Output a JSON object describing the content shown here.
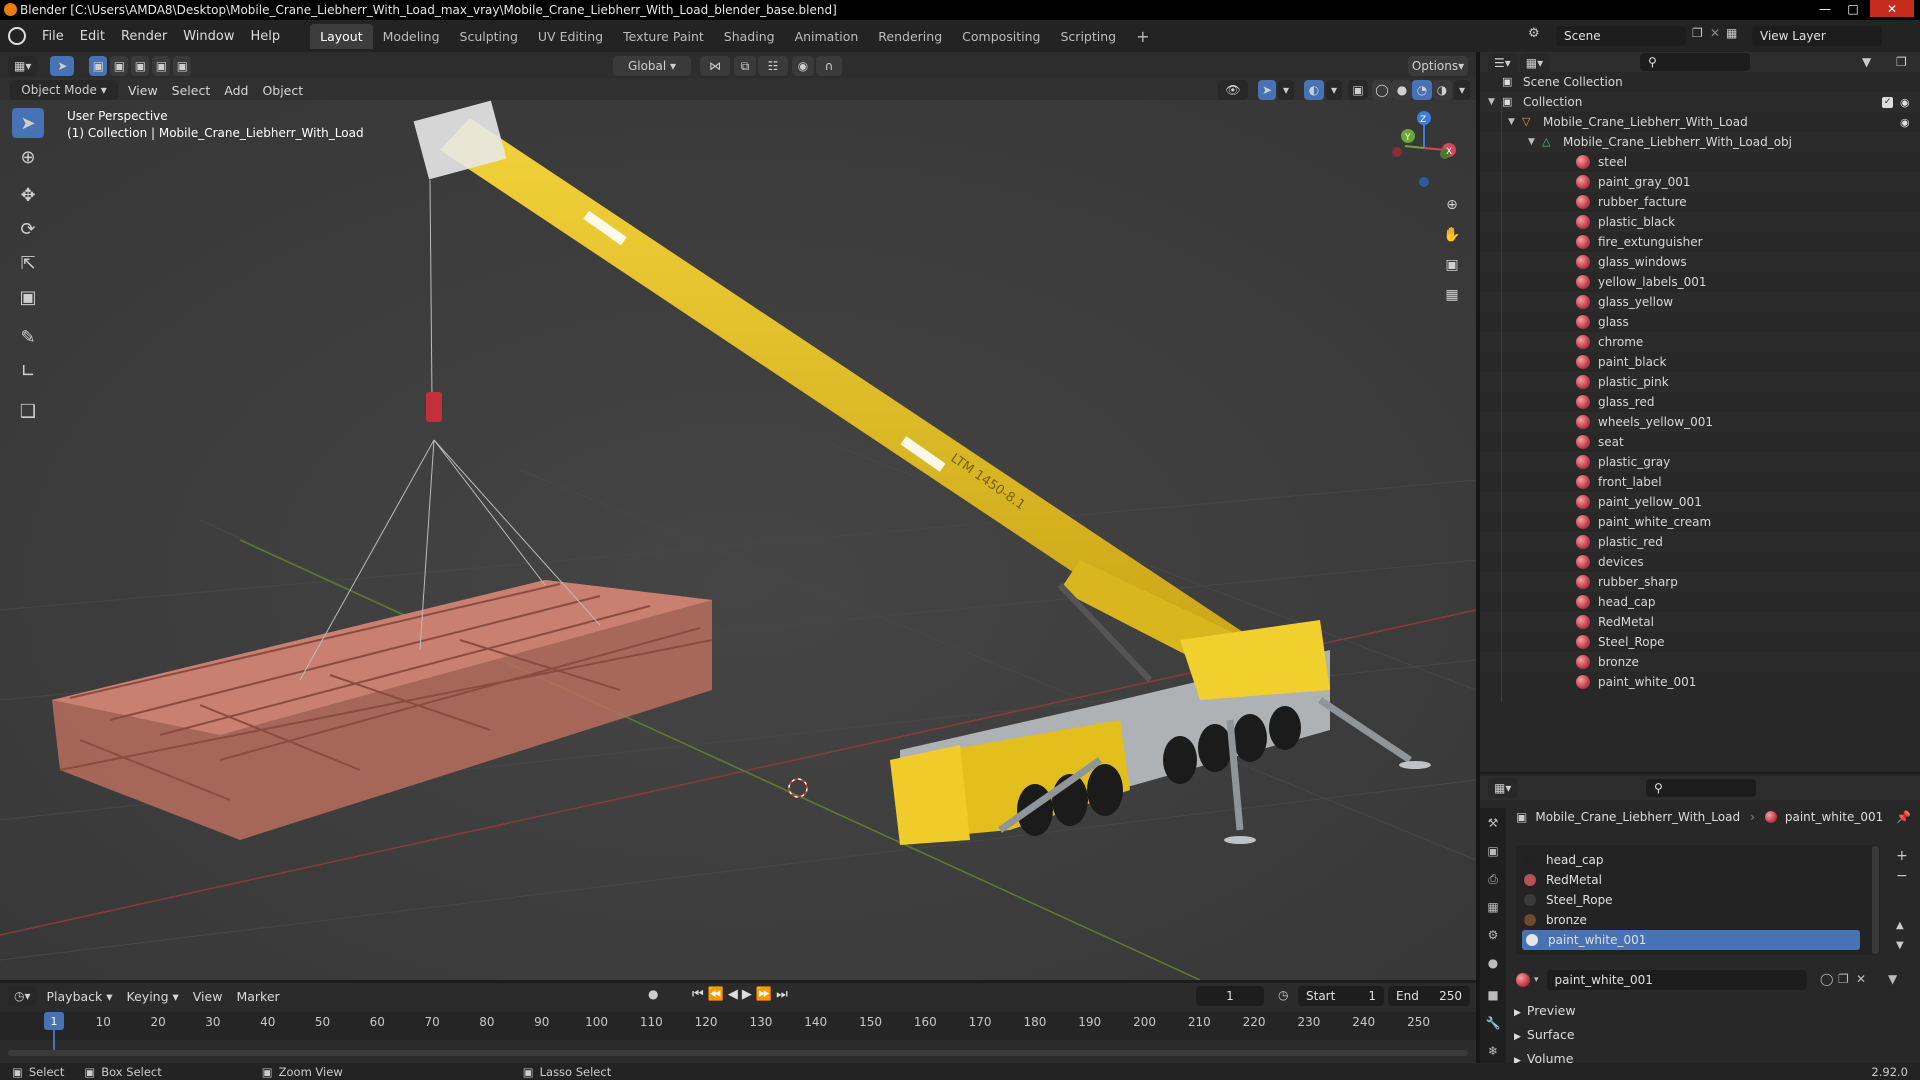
{
  "title": "Blender [C:\\Users\\AMDA8\\Desktop\\Mobile_Crane_Liebherr_With_Load_max_vray\\Mobile_Crane_Liebherr_With_Load_blender_base.blend]",
  "menu": [
    "File",
    "Edit",
    "Render",
    "Window",
    "Help"
  ],
  "workspaces": [
    "Layout",
    "Modeling",
    "Sculpting",
    "UV Editing",
    "Texture Paint",
    "Shading",
    "Animation",
    "Rendering",
    "Compositing",
    "Scripting"
  ],
  "scene_name": "Scene",
  "view_layer": "View Layer",
  "viewport_header": {
    "transform": "Global",
    "options": "Options",
    "mode": "Object Mode",
    "menus": [
      "View",
      "Select",
      "Add",
      "Object"
    ]
  },
  "overlay": {
    "perspective": "User Perspective",
    "collection": "(1) Collection | Mobile_Crane_Liebherr_With_Load"
  },
  "crane_label": "LTM 1450-8.1",
  "axes": {
    "x": "X",
    "y": "Y",
    "z": "Z"
  },
  "outliner": {
    "scene_collection": "Scene Collection",
    "collection": "Collection",
    "object": "Mobile_Crane_Liebherr_With_Load",
    "mesh": "Mobile_Crane_Liebherr_With_Load_obj",
    "materials": [
      "steel",
      "paint_gray_001",
      "rubber_facture",
      "plastic_black",
      "fire_extunguisher",
      "glass_windows",
      "yellow_labels_001",
      "glass_yellow",
      "glass",
      "chrome",
      "paint_black",
      "plastic_pink",
      "glass_red",
      "wheels_yellow_001",
      "seat",
      "plastic_gray",
      "front_label",
      "paint_yellow_001",
      "paint_white_cream",
      "plastic_red",
      "devices",
      "rubber_sharp",
      "head_cap",
      "RedMetal",
      "Steel_Rope",
      "bronze",
      "paint_white_001"
    ]
  },
  "properties": {
    "breadcrumb_object": "Mobile_Crane_Liebherr_With_Load",
    "breadcrumb_material": "paint_white_001",
    "slots": [
      {
        "name": "head_cap",
        "color": "#222222"
      },
      {
        "name": "RedMetal",
        "color": "#b5525a"
      },
      {
        "name": "Steel_Rope",
        "color": "#3a3a3a"
      },
      {
        "name": "bronze",
        "color": "#6b4a2f"
      },
      {
        "name": "paint_white_001",
        "color": "#e6e6e6"
      }
    ],
    "material_name": "paint_white_001",
    "panels": [
      "Preview",
      "Surface",
      "Volume"
    ]
  },
  "timeline": {
    "menus": [
      "Playback",
      "Keying",
      "View",
      "Marker"
    ],
    "current_frame": "1",
    "start_label": "Start",
    "start": "1",
    "end_label": "End",
    "end": "250",
    "ticks": [
      "1",
      "10",
      "20",
      "30",
      "40",
      "50",
      "60",
      "70",
      "80",
      "90",
      "100",
      "110",
      "120",
      "130",
      "140",
      "150",
      "160",
      "170",
      "180",
      "190",
      "200",
      "210",
      "220",
      "230",
      "240",
      "250"
    ]
  },
  "statusbar": {
    "select": "Select",
    "box_select": "Box Select",
    "zoom_view": "Zoom View",
    "lasso_select": "Lasso Select",
    "version": "2.92.0"
  }
}
